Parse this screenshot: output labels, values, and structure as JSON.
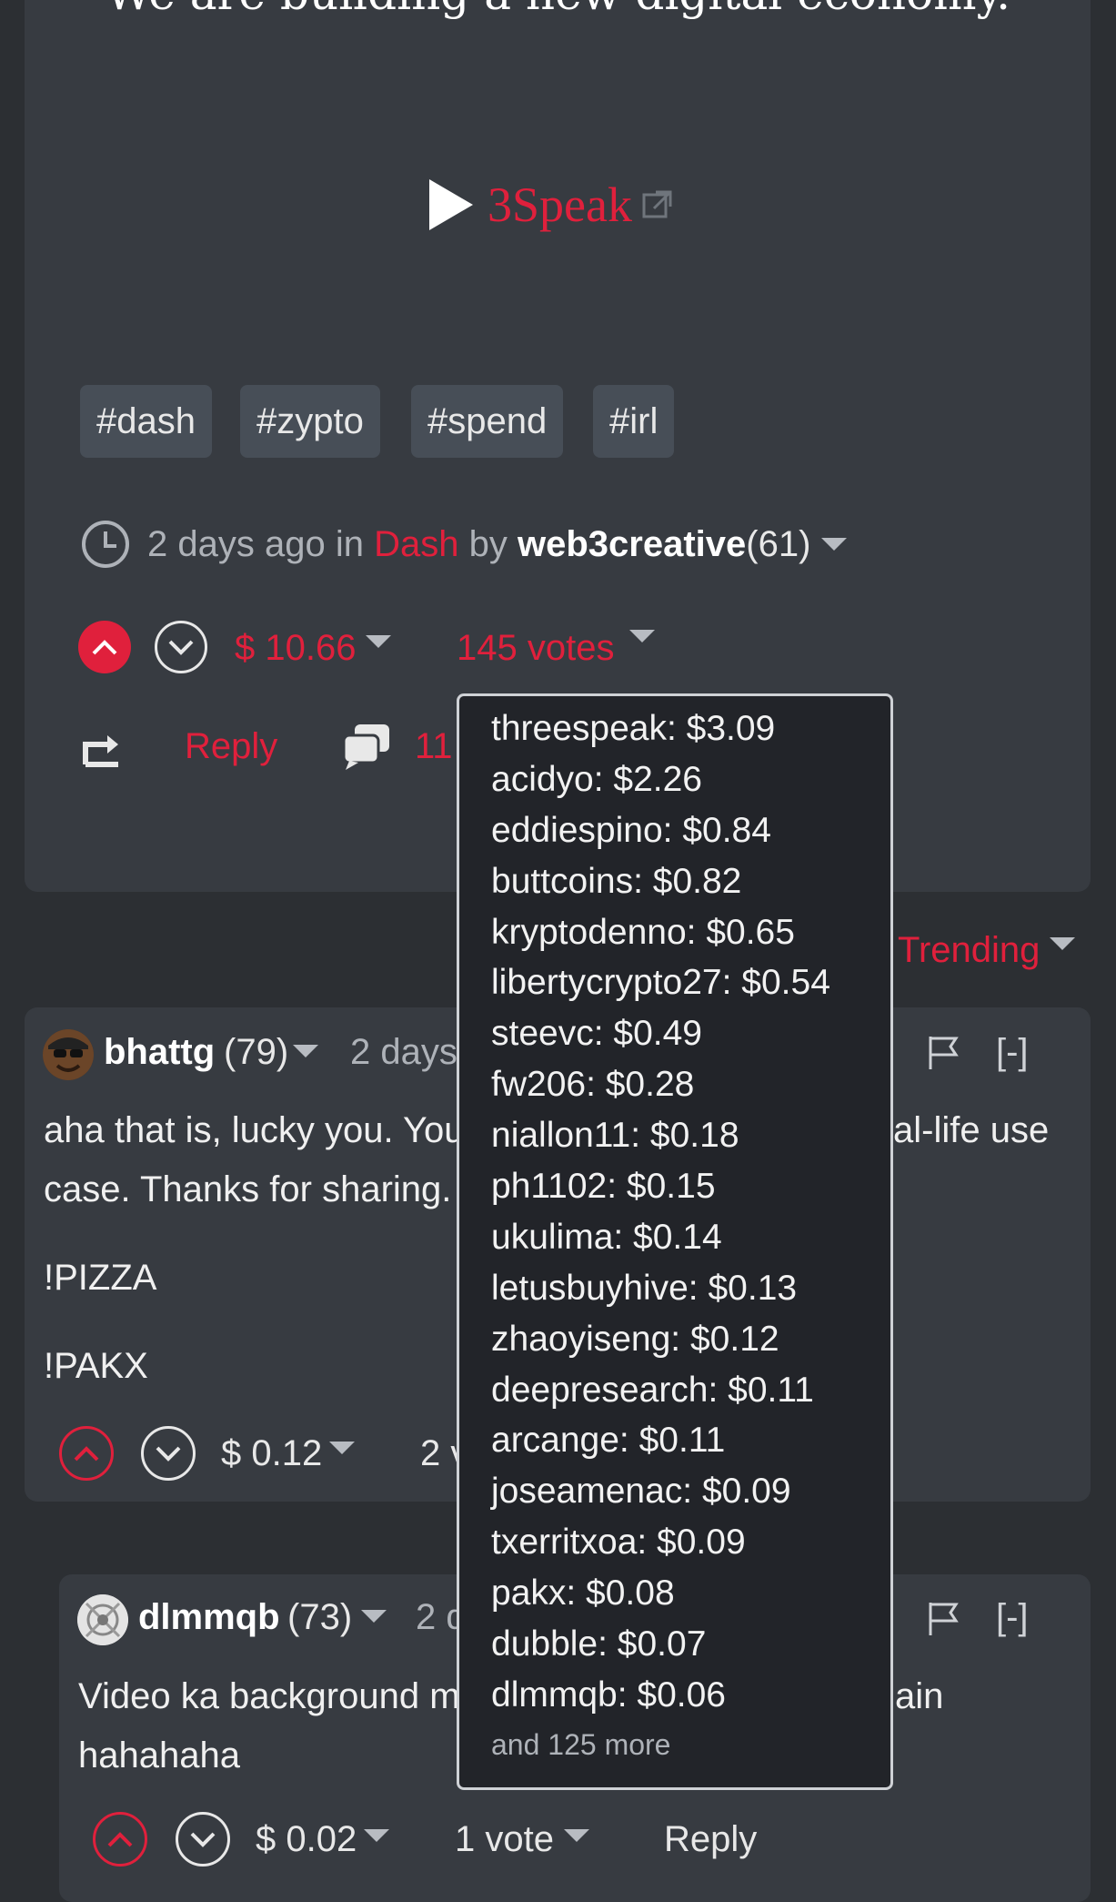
{
  "post": {
    "headline": "We are building a new digital economy.",
    "video_link": "3Speak",
    "tags": [
      "#dash",
      "#zypto",
      "#spend",
      "#irl"
    ],
    "meta": {
      "time": "2 days ago in",
      "community": "Dash",
      "by": "by",
      "author": "web3creative",
      "reputation": "(61)"
    },
    "payout": "$ 10.66",
    "votes": "145 votes",
    "reply_label": "Reply",
    "comment_count": "11"
  },
  "sort": {
    "label": "Trending"
  },
  "tooltip": {
    "voters": [
      "threespeak: $3.09",
      "acidyo: $2.26",
      "eddiespino: $0.84",
      "buttcoins: $0.82",
      "kryptodenno: $0.65",
      "libertycrypto27: $0.54",
      "steevc: $0.49",
      "fw206: $0.28",
      "niallon11: $0.18",
      "ph1102: $0.15",
      "ukulima: $0.14",
      "letusbuyhive: $0.13",
      "zhaoyiseng: $0.12",
      "deepresearch: $0.11",
      "arcange: $0.11",
      "joseamenac: $0.09",
      "txerritxoa: $0.09",
      "pakx: $0.08",
      "dubble: $0.07",
      "dlmmqb: $0.06"
    ],
    "more": "and 125 more"
  },
  "comments": [
    {
      "author": "bhattg",
      "reputation": "(79)",
      "time": "2 days",
      "body_line1_left": "aha that is, lucky you. You",
      "body_line1_right": "al-life use",
      "body_line2": "case. Thanks for sharing.",
      "body_line3": "!PIZZA",
      "body_line4": "!PAKX",
      "payout": "$ 0.12",
      "votes_partial": "2 v",
      "collapse": "[-]"
    },
    {
      "author": "dlmmqb",
      "reputation": "(73)",
      "time": "2 d",
      "body_line1_left": "Video ka background m",
      "body_line1_right": "ain",
      "body_line2": "hahahaha",
      "payout": "$ 0.02",
      "votes": "1 vote",
      "reply_label": "Reply",
      "collapse": "[-]"
    }
  ],
  "colors": {
    "accent": "#e0203c",
    "background": "#2c2f33",
    "card": "#373b41",
    "tag": "#474e57"
  },
  "icons": [
    "clock-icon",
    "upvote-icon",
    "downvote-icon",
    "caret-down-icon",
    "reblog-icon",
    "comments-icon",
    "flag-icon",
    "play-icon",
    "external-link-icon"
  ]
}
